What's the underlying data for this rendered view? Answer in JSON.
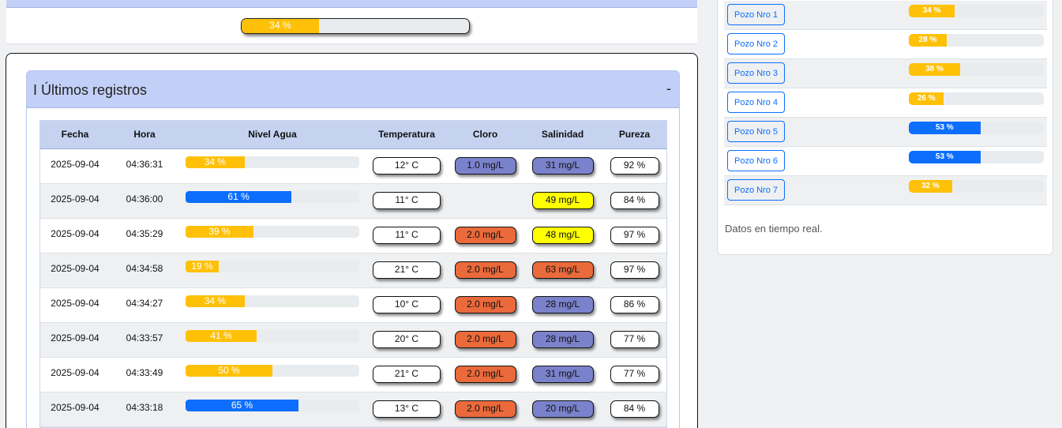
{
  "colors": {
    "yellow_fill": "#ffc107",
    "blue_fill": "#0d6efd",
    "chlorine_orange": "#ea6a3b",
    "purple_blue": "#7b82cc",
    "salinity_yellow": "#ffff00",
    "header_blue": "#c2d0f7"
  },
  "top_progress": {
    "label": "34 %",
    "value": 34,
    "color": "yellow"
  },
  "panel": {
    "title": "I Últimos registros",
    "toggle": "-"
  },
  "table": {
    "headers": [
      "Fecha",
      "Hora",
      "Nivel Agua",
      "Temperatura",
      "Cloro",
      "Salinidad",
      "Pureza"
    ],
    "rows": [
      {
        "fecha": "2025-09-04",
        "hora": "04:36:31",
        "nivel": 34,
        "nivel_label": "34 %",
        "nivel_color": "yellow",
        "temp": "12° C",
        "cloro": "1.0 mg/L",
        "cloro_color": "purple",
        "sal": "31 mg/L",
        "sal_color": "purple",
        "pureza": "92 %"
      },
      {
        "fecha": "2025-09-04",
        "hora": "04:36:00",
        "nivel": 61,
        "nivel_label": "61 %",
        "nivel_color": "blue",
        "temp": "11° C",
        "cloro": "",
        "cloro_color": "none",
        "sal": "49 mg/L",
        "sal_color": "yellow",
        "pureza": "84 %"
      },
      {
        "fecha": "2025-09-04",
        "hora": "04:35:29",
        "nivel": 39,
        "nivel_label": "39 %",
        "nivel_color": "yellow",
        "temp": "11° C",
        "cloro": "2.0 mg/L",
        "cloro_color": "orange",
        "sal": "48 mg/L",
        "sal_color": "yellow",
        "pureza": "97 %"
      },
      {
        "fecha": "2025-09-04",
        "hora": "04:34:58",
        "nivel": 19,
        "nivel_label": "19 %",
        "nivel_color": "yellow",
        "temp": "21° C",
        "cloro": "2.0 mg/L",
        "cloro_color": "orange",
        "sal": "63 mg/L",
        "sal_color": "orange",
        "pureza": "97 %"
      },
      {
        "fecha": "2025-09-04",
        "hora": "04:34:27",
        "nivel": 34,
        "nivel_label": "34 %",
        "nivel_color": "yellow",
        "temp": "10° C",
        "cloro": "2.0 mg/L",
        "cloro_color": "orange",
        "sal": "28 mg/L",
        "sal_color": "purple",
        "pureza": "86 %"
      },
      {
        "fecha": "2025-09-04",
        "hora": "04:33:57",
        "nivel": 41,
        "nivel_label": "41 %",
        "nivel_color": "yellow",
        "temp": "20° C",
        "cloro": "2.0 mg/L",
        "cloro_color": "orange",
        "sal": "28 mg/L",
        "sal_color": "purple",
        "pureza": "77 %"
      },
      {
        "fecha": "2025-09-04",
        "hora": "04:33:49",
        "nivel": 50,
        "nivel_label": "50 %",
        "nivel_color": "yellow",
        "temp": "21° C",
        "cloro": "2.0 mg/L",
        "cloro_color": "orange",
        "sal": "31 mg/L",
        "sal_color": "purple",
        "pureza": "77 %"
      },
      {
        "fecha": "2025-09-04",
        "hora": "04:33:18",
        "nivel": 65,
        "nivel_label": "65 %",
        "nivel_color": "blue",
        "temp": "13° C",
        "cloro": "2.0 mg/L",
        "cloro_color": "orange",
        "sal": "20 mg/L",
        "sal_color": "purple",
        "pureza": "84 %"
      }
    ]
  },
  "pozos": [
    {
      "label": "Pozo Nro 1",
      "value": 34,
      "value_label": "34 %",
      "color": "yellow"
    },
    {
      "label": "Pozo Nro 2",
      "value": 28,
      "value_label": "28 %",
      "color": "yellow"
    },
    {
      "label": "Pozo Nro 3",
      "value": 38,
      "value_label": "38 %",
      "color": "yellow"
    },
    {
      "label": "Pozo Nro 4",
      "value": 26,
      "value_label": "26 %",
      "color": "yellow"
    },
    {
      "label": "Pozo Nro 5",
      "value": 53,
      "value_label": "53 %",
      "color": "blue"
    },
    {
      "label": "Pozo Nro 6",
      "value": 53,
      "value_label": "53 %",
      "color": "blue"
    },
    {
      "label": "Pozo Nro 7",
      "value": 32,
      "value_label": "32 %",
      "color": "yellow"
    }
  ],
  "realtime_note": "Datos en tiempo real."
}
